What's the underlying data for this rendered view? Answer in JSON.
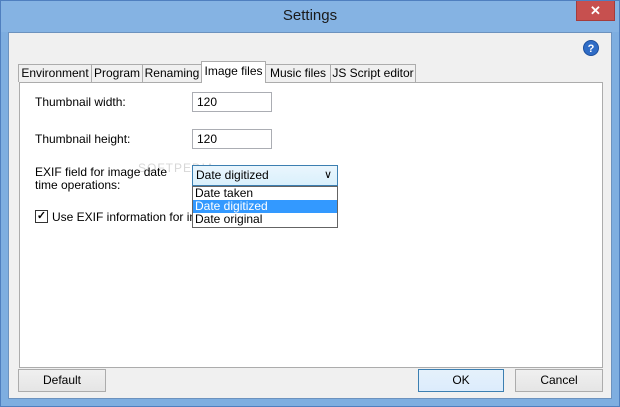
{
  "window": {
    "title": "Settings",
    "close_glyph": "✕",
    "help_glyph": "?"
  },
  "tabs": [
    {
      "label": "Environment",
      "active": false
    },
    {
      "label": "Program",
      "active": false
    },
    {
      "label": "Renaming",
      "active": false
    },
    {
      "label": "Image files",
      "active": true
    },
    {
      "label": "Music files",
      "active": false
    },
    {
      "label": "JS Script editor",
      "active": false
    }
  ],
  "image_files": {
    "thumb_width_label": "Thumbnail width:",
    "thumb_width_value": "120",
    "thumb_height_label": "Thumbnail height:",
    "thumb_height_value": "120",
    "exif_label": "EXIF field for image date time operations:",
    "exif_selected": "Date digitized",
    "exif_options": [
      "Date taken",
      "Date digitized",
      "Date original"
    ],
    "use_exif_label": "Use EXIF information for imag",
    "use_exif_checked": true,
    "watermark": "SOFTPEDIA"
  },
  "footer": {
    "default_label": "Default",
    "ok_label": "OK",
    "cancel_label": "Cancel"
  }
}
